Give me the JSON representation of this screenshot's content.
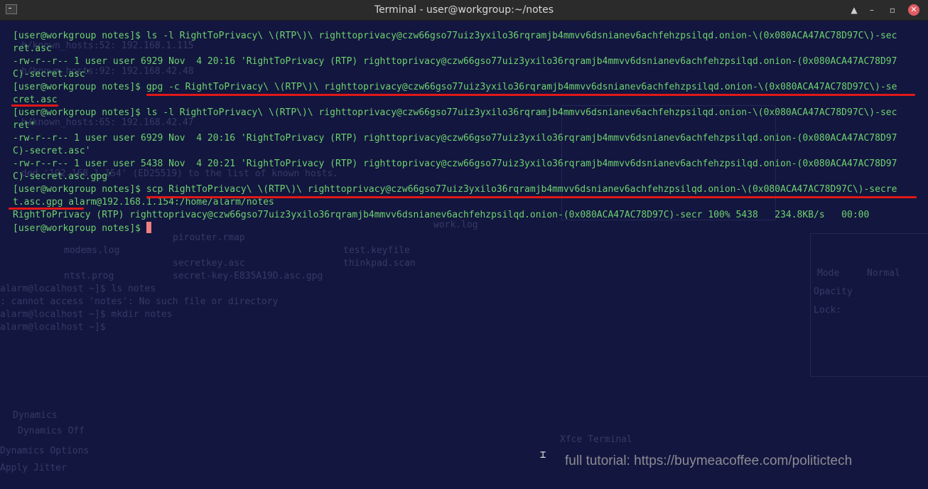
{
  "window": {
    "title": "Terminal - user@workgroup:~/notes",
    "buttons": {
      "shade": "▲",
      "minimize": "–",
      "maximize": "▫",
      "close": "✕"
    }
  },
  "terminal": {
    "lines": [
      "[user@workgroup notes]$ ls -l RightToPrivacy\\ \\(RTP\\)\\ righttoprivacy@czw66gso77uiz3yxilo36rqramjb4mmvv6dsnianev6achfehzpsilqd.onion-\\(0x080ACA47AC78D97C\\)-sec",
      "ret.asc",
      "-rw-r--r-- 1 user user 6929 Nov  4 20:16 'RightToPrivacy (RTP) righttoprivacy@czw66gso77uiz3yxilo36rqramjb4mmvv6dsnianev6achfehzpsilqd.onion-(0x080ACA47AC78D97",
      "C)-secret.asc'",
      "[user@workgroup notes]$ gpg -c RightToPrivacy\\ \\(RTP\\)\\ righttoprivacy@czw66gso77uiz3yxilo36rqramjb4mmvv6dsnianev6achfehzpsilqd.onion-\\(0x080ACA47AC78D97C\\)-se",
      "cret.asc",
      "[user@workgroup notes]$ ls -l RightToPrivacy\\ \\(RTP\\)\\ righttoprivacy@czw66gso77uiz3yxilo36rqramjb4mmvv6dsnianev6achfehzpsilqd.onion-\\(0x080ACA47AC78D97C\\)-sec",
      "ret*",
      "-rw-r--r-- 1 user user 6929 Nov  4 20:16 'RightToPrivacy (RTP) righttoprivacy@czw66gso77uiz3yxilo36rqramjb4mmvv6dsnianev6achfehzpsilqd.onion-(0x080ACA47AC78D97",
      "C)-secret.asc'",
      "-rw-r--r-- 1 user user 5438 Nov  4 20:21 'RightToPrivacy (RTP) righttoprivacy@czw66gso77uiz3yxilo36rqramjb4mmvv6dsnianev6achfehzpsilqd.onion-(0x080ACA47AC78D97",
      "C)-secret.asc.gpg'",
      "[user@workgroup notes]$ scp RightToPrivacy\\ \\(RTP\\)\\ righttoprivacy@czw66gso77uiz3yxilo36rqramjb4mmvv6dsnianev6achfehzpsilqd.onion-\\(0x080ACA47AC78D97C\\)-secre",
      "t.asc.gpg alarm@192.168.1.154:/home/alarm/notes",
      "RightToPrivacy (RTP) righttoprivacy@czw66gso77uiz3yxilo36rqramjb4mmvv6dsnianev6achfehzpsilqd.onion-(0x080ACA47AC78D97C)-secr 100% 5438   234.8KB/s   00:00"
    ],
    "prompt": "[user@workgroup notes]$ "
  },
  "background_ghost": {
    "lines": [
      "h/known_hosts:52: 192.168.1.115",
      "h/known_hosts:92: 192.168.42.48",
      "h/known_hosts:65: 192.168.42.47",
      "ded '192.168.1.154' (ED25519) to the list of known hosts.",
      "modems.log",
      "ntst.prog",
      "pirouter.rmap",
      "secretkey.asc",
      "secret-key-E835A19D.asc.gpg",
      "test.keyfile",
      "thinkpad.scan",
      "alarm@localhost ~]$ ls notes",
      ": cannot access 'notes': No such file or directory",
      "alarm@localhost ~]$ mkdir notes",
      "alarm@localhost ~]$",
      "Mode",
      "Normal",
      "Opacity",
      "Lock:",
      "Dynamics",
      "Dynamics Off",
      "Dynamics Options",
      "Apply Jitter",
      "Xfce Terminal",
      "work.log"
    ]
  },
  "overlay_text": "full tutorial: https://buymeacoffee.com/politictech",
  "colors": {
    "terminal_bg": "#13163f",
    "terminal_fg": "#6ed36f",
    "cursor": "#f08080",
    "annotation_underline": "#e01818",
    "titlebar_bg": "#2b2b2b"
  },
  "icons": {
    "app": "terminal-icon",
    "shade": "shade-icon",
    "minimize": "minimize-icon",
    "maximize": "maximize-icon",
    "close": "close-icon",
    "mouse_cursor": "text-cursor-icon"
  }
}
